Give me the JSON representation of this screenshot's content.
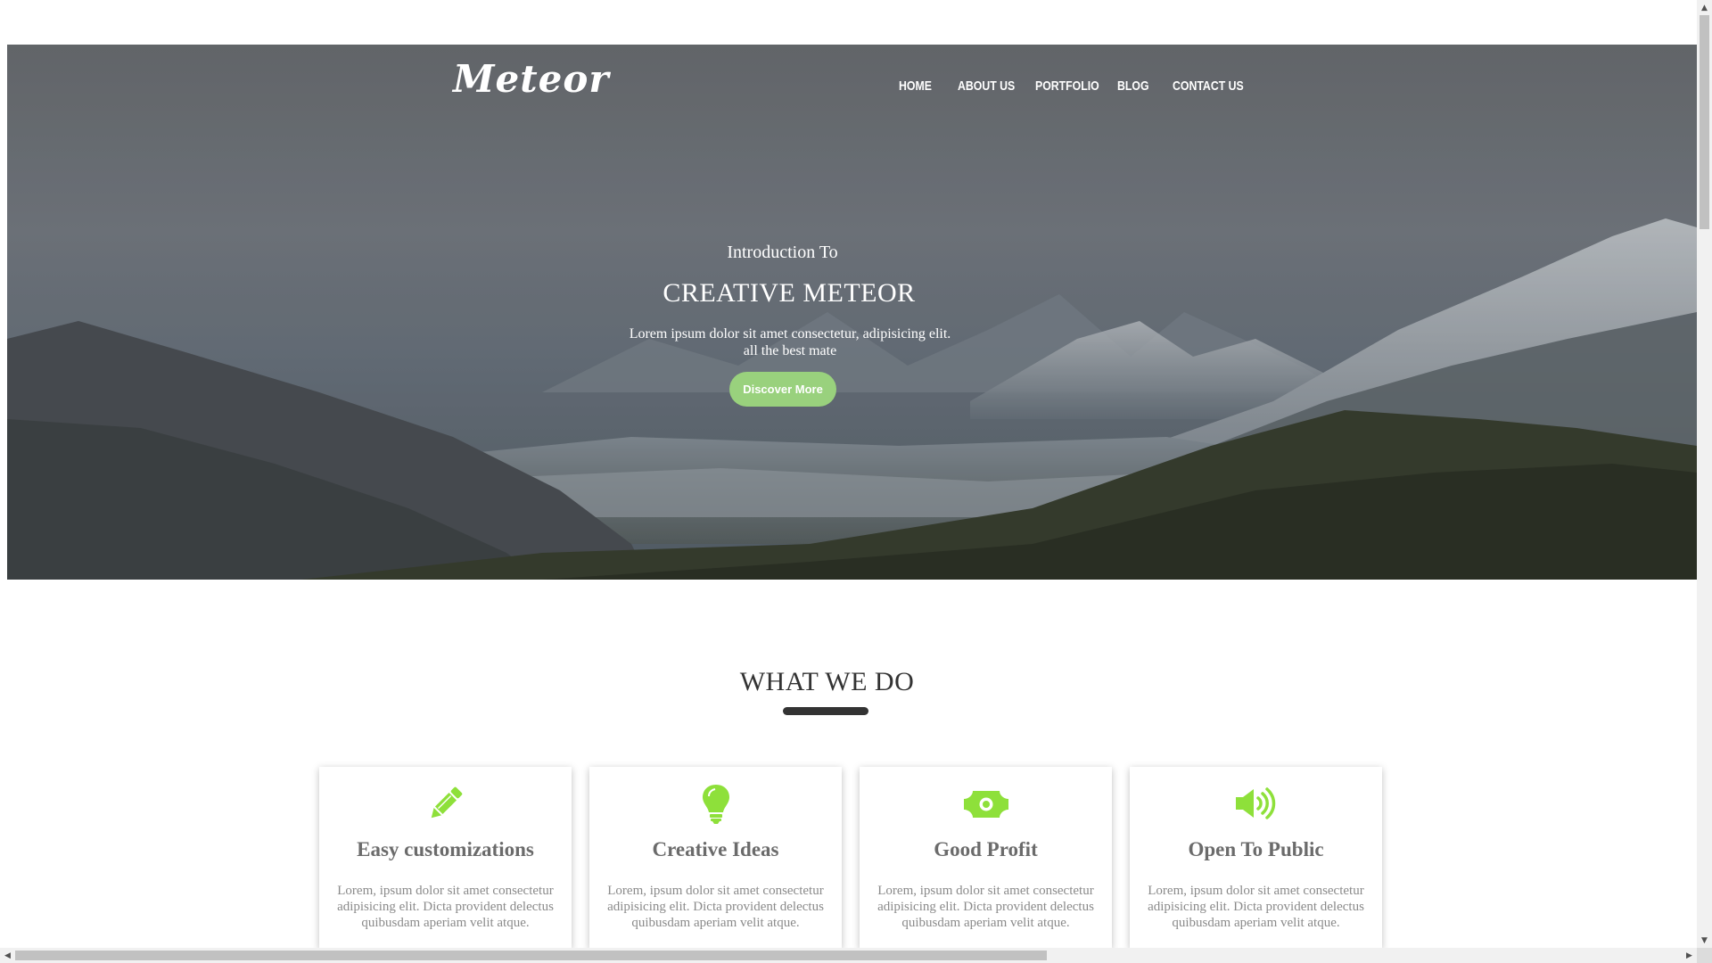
{
  "header": {
    "logo": "Meteor",
    "nav": [
      {
        "label": "HOME"
      },
      {
        "label": "ABOUT US"
      },
      {
        "label": "PORTFOLIO"
      },
      {
        "label": "BLOG"
      },
      {
        "label": "CONTACT US"
      }
    ]
  },
  "hero": {
    "intro": "Introduction To",
    "title": "CREATIVE METEOR",
    "description_line1": "Lorem ipsum dolor sit amet consectetur, adipisicing elit.",
    "description_line2": "all the best mate",
    "button_label": "Discover More"
  },
  "services": {
    "title": "WHAT WE DO",
    "cards": [
      {
        "icon": "pencil-icon",
        "title": "Easy customizations",
        "text": "Lorem, ipsum dolor sit amet consectetur adipisicing elit. Dicta provident delectus quibusdam aperiam velit atque."
      },
      {
        "icon": "lightbulb-icon",
        "title": "Creative Ideas",
        "text": "Lorem, ipsum dolor sit amet consectetur adipisicing elit. Dicta provident delectus quibusdam aperiam velit atque."
      },
      {
        "icon": "money-icon",
        "title": "Good Profit",
        "text": "Lorem, ipsum dolor sit amet consectetur adipisicing elit. Dicta provident delectus quibusdam aperiam velit atque."
      },
      {
        "icon": "megaphone-icon",
        "title": "Open To Public",
        "text": "Lorem, ipsum dolor sit amet consectetur adipisicing elit. Dicta provident delectus quibusdam aperiam velit atque."
      }
    ]
  },
  "colors": {
    "accent": "#99d17d",
    "icon_green": "#8ee03a",
    "heading_dark": "#333333"
  }
}
